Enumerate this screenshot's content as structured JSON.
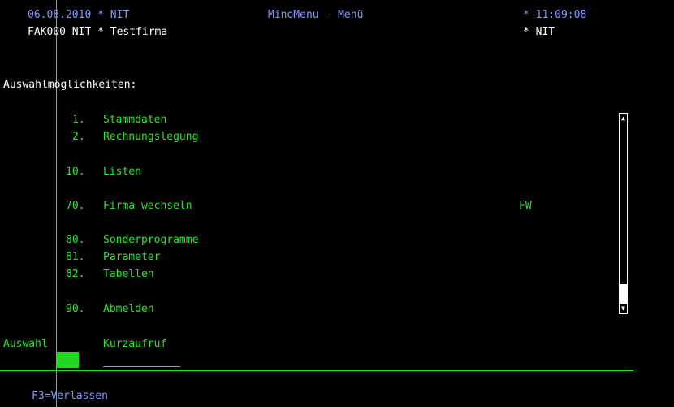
{
  "header": {
    "date_user": "06.08.2010 * NIT",
    "title": "MinoMenu - Menü",
    "time": "* 11:09:08",
    "company": "FAK000 NIT * Testfirma",
    "user": "* NIT"
  },
  "section_title": "Auswahlmöglichkeiten:",
  "menu_items": [
    {
      "num": "1.",
      "label": "Stammdaten",
      "shortcut": ""
    },
    {
      "num": "2.",
      "label": "Rechnungslegung",
      "shortcut": ""
    },
    {
      "num": "10.",
      "label": "Listen",
      "shortcut": ""
    },
    {
      "num": "70.",
      "label": "Firma wechseln",
      "shortcut": "FW"
    },
    {
      "num": "80.",
      "label": "Sonderprogramme",
      "shortcut": ""
    },
    {
      "num": "81.",
      "label": "Parameter",
      "shortcut": ""
    },
    {
      "num": "82.",
      "label": "Tabellen",
      "shortcut": ""
    },
    {
      "num": "90.",
      "label": "Abmelden",
      "shortcut": ""
    }
  ],
  "input": {
    "auswahl_label": "Auswahl",
    "kurzaufruf_label": "Kurzaufruf"
  },
  "footer": {
    "f3": "F3=Verlassen"
  },
  "colors": {
    "background": "#000000",
    "green": "#2fe02f",
    "blue": "#7f9bff",
    "white": "#ffffff"
  }
}
